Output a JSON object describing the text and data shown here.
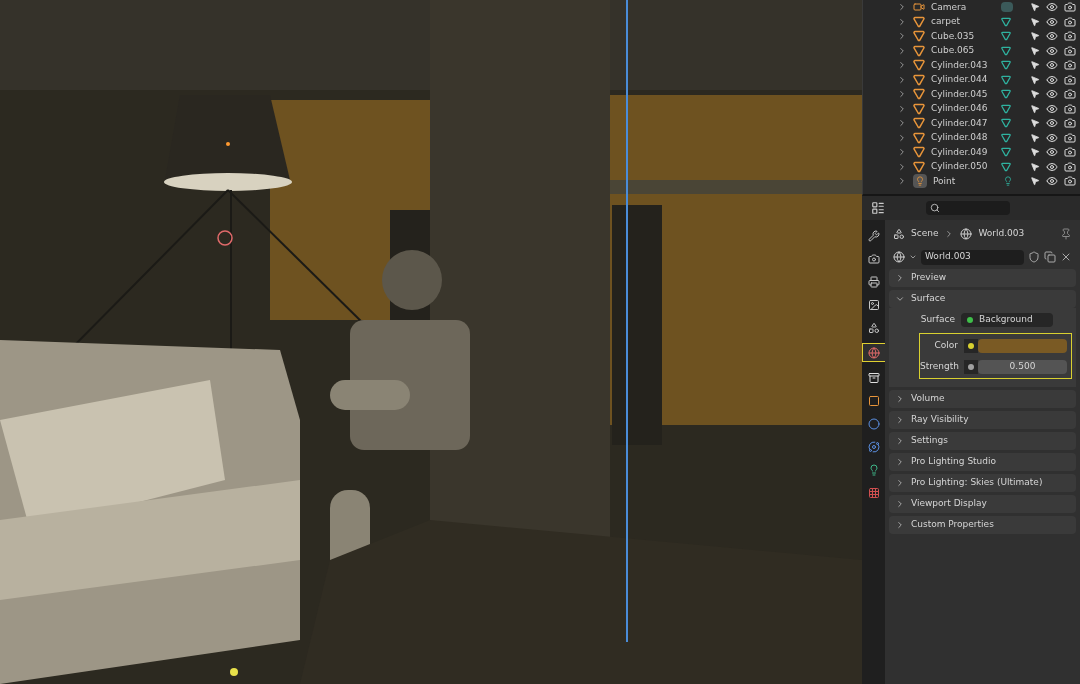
{
  "viewport": {
    "kind": "render"
  },
  "outliner": {
    "rows": [
      {
        "name": "Camera",
        "kind": "camera"
      },
      {
        "name": "carpet",
        "kind": "mesh"
      },
      {
        "name": "Cube.035",
        "kind": "mesh"
      },
      {
        "name": "Cube.065",
        "kind": "mesh"
      },
      {
        "name": "Cylinder.043",
        "kind": "mesh"
      },
      {
        "name": "Cylinder.044",
        "kind": "mesh"
      },
      {
        "name": "Cylinder.045",
        "kind": "mesh"
      },
      {
        "name": "Cylinder.046",
        "kind": "mesh"
      },
      {
        "name": "Cylinder.047",
        "kind": "mesh"
      },
      {
        "name": "Cylinder.048",
        "kind": "mesh"
      },
      {
        "name": "Cylinder.049",
        "kind": "mesh"
      },
      {
        "name": "Cylinder.050",
        "kind": "mesh"
      },
      {
        "name": "Point",
        "kind": "light"
      }
    ]
  },
  "properties": {
    "tabs": [
      {
        "kind": "tool",
        "selected": false
      },
      {
        "kind": "render",
        "selected": false
      },
      {
        "kind": "output",
        "selected": false
      },
      {
        "kind": "view_layer",
        "selected": false
      },
      {
        "kind": "scene",
        "selected": false
      },
      {
        "kind": "world",
        "selected": true
      },
      {
        "kind": "collection",
        "selected": false
      },
      {
        "kind": "object",
        "selected": false
      },
      {
        "kind": "physics",
        "selected": false
      },
      {
        "kind": "constraints",
        "selected": false
      },
      {
        "kind": "data",
        "selected": false
      },
      {
        "kind": "texture",
        "selected": false
      }
    ],
    "breadcrumb": [
      "Scene",
      "World.003"
    ],
    "world_field": "World.003",
    "panels": [
      {
        "title": "Preview",
        "expanded": false
      },
      {
        "title": "Surface",
        "expanded": true
      },
      {
        "title": "Volume",
        "expanded": false
      },
      {
        "title": "Ray Visibility",
        "expanded": false
      },
      {
        "title": "Settings",
        "expanded": false
      },
      {
        "title": "Pro Lighting Studio",
        "expanded": false
      },
      {
        "title": "Pro Lighting: Skies (Ultimate)",
        "expanded": false
      },
      {
        "title": "Viewport Display",
        "expanded": false
      },
      {
        "title": "Custom Properties",
        "expanded": false
      }
    ],
    "surface": {
      "label": "Surface",
      "shader": "Background",
      "color_label": "Color",
      "color": "#7a5a24",
      "strength_label": "Strength",
      "strength": "0.500"
    }
  }
}
